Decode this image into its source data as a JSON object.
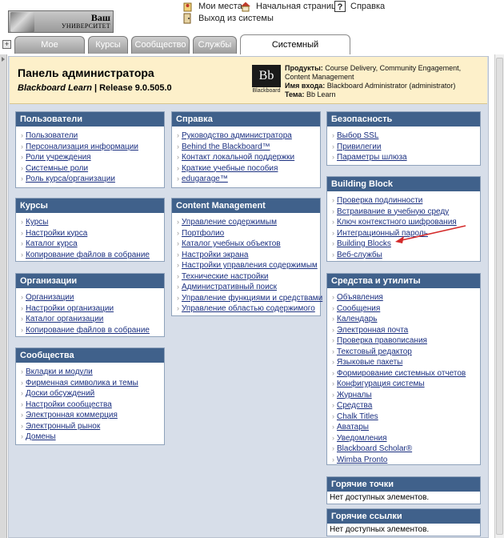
{
  "header": {
    "logo_line1": "Ваш",
    "logo_line2": "УНИВЕРСИТЕТ",
    "links": [
      {
        "label": "Мои места"
      },
      {
        "label": "Начальная страница"
      },
      {
        "label": "Справка"
      },
      {
        "label": "Выход из системы"
      }
    ]
  },
  "tabs": [
    {
      "label": "Мое учреждение"
    },
    {
      "label": "Курсы"
    },
    {
      "label": "Сообщество"
    },
    {
      "label": "Службы"
    },
    {
      "label": "Системный администратор"
    }
  ],
  "panel": {
    "title": "Панель администратора",
    "product_name": "Blackboard Learn",
    "release": " | Release 9.0.505.0",
    "bb_logo_text": "Bb",
    "bb_logo_caption": "Blackboard",
    "products_label": "Продукты:",
    "products_value": " Course Delivery, Community Engagement, Content Management",
    "login_label": "Имя входа:",
    "login_value": " Blackboard Administrator (administrator)",
    "theme_label": "Тема:",
    "theme_value": " Bb Learn"
  },
  "modules": {
    "users": {
      "title": "Пользователи",
      "items": [
        "Пользователи",
        "Персонализация информации ",
        "Роли учреждения",
        "Системные роли",
        "Роль курса/организации"
      ]
    },
    "courses": {
      "title": "Курсы",
      "items": [
        "Курсы",
        "Настройки курса",
        "Каталог курса",
        "Копирование файлов в собрание"
      ]
    },
    "orgs": {
      "title": "Организации",
      "items": [
        "Организации",
        "Настройки организации",
        "Каталог организации",
        "Копирование файлов в собрание"
      ]
    },
    "communities": {
      "title": "Сообщества",
      "items": [
        "Вкладки и модули",
        "Фирменная символика и темы",
        "Доски обсуждений",
        "Настройки сообщества",
        "Электронная коммерция",
        "Электронный рынок",
        "Домены"
      ]
    },
    "help": {
      "title": "Справка",
      "items": [
        "Руководство администратора",
        "Behind the Blackboard™",
        "Контакт локальной поддержки",
        "Краткие учебные пособия",
        "edugarage™"
      ]
    },
    "content": {
      "title": "Content Management",
      "items": [
        "Управление содержимым",
        "Портфолио",
        "Каталог учебных объектов",
        "Настройки экрана",
        "Настройки управления содержимым",
        "Технические настройки",
        "Административный поиск",
        "Управление функциями и средствами",
        "Управление областью содержимого"
      ]
    },
    "security": {
      "title": "Безопасность",
      "items": [
        "Выбор SSL",
        "Привилегии",
        "Параметры шлюза"
      ]
    },
    "building": {
      "title": "Building Block",
      "items": [
        "Проверка подлинности",
        "Встраивание в учебную среду",
        "Ключ контекстного шифрования",
        "Интеграционный пароль",
        "Building Blocks",
        "Веб-службы"
      ]
    },
    "tools": {
      "title": "Средства и утилиты",
      "items": [
        "Объявления",
        "Сообщения",
        "Календарь",
        "Электронная почта",
        "Проверка правописания",
        "Текстовый редактор",
        "Языковые пакеты",
        "Формирование системных отчетов",
        "Конфигурация системы",
        "Журналы",
        "Средства",
        "Chalk Titles",
        "Аватары",
        "Уведомления",
        "Blackboard Scholar®",
        "Wimba Pronto"
      ]
    },
    "hotspots": {
      "title": "Горячие точки",
      "empty": "Нет доступных элементов."
    },
    "hotlinks": {
      "title": "Горячие ссылки",
      "empty": "Нет доступных элементов."
    }
  },
  "colors": {
    "module_header": "#40618b",
    "panel_bg": "#fdf0ca",
    "content_bg": "#d7dee9",
    "link": "#1a2f80",
    "annotation_arrow": "#d42a2a"
  }
}
